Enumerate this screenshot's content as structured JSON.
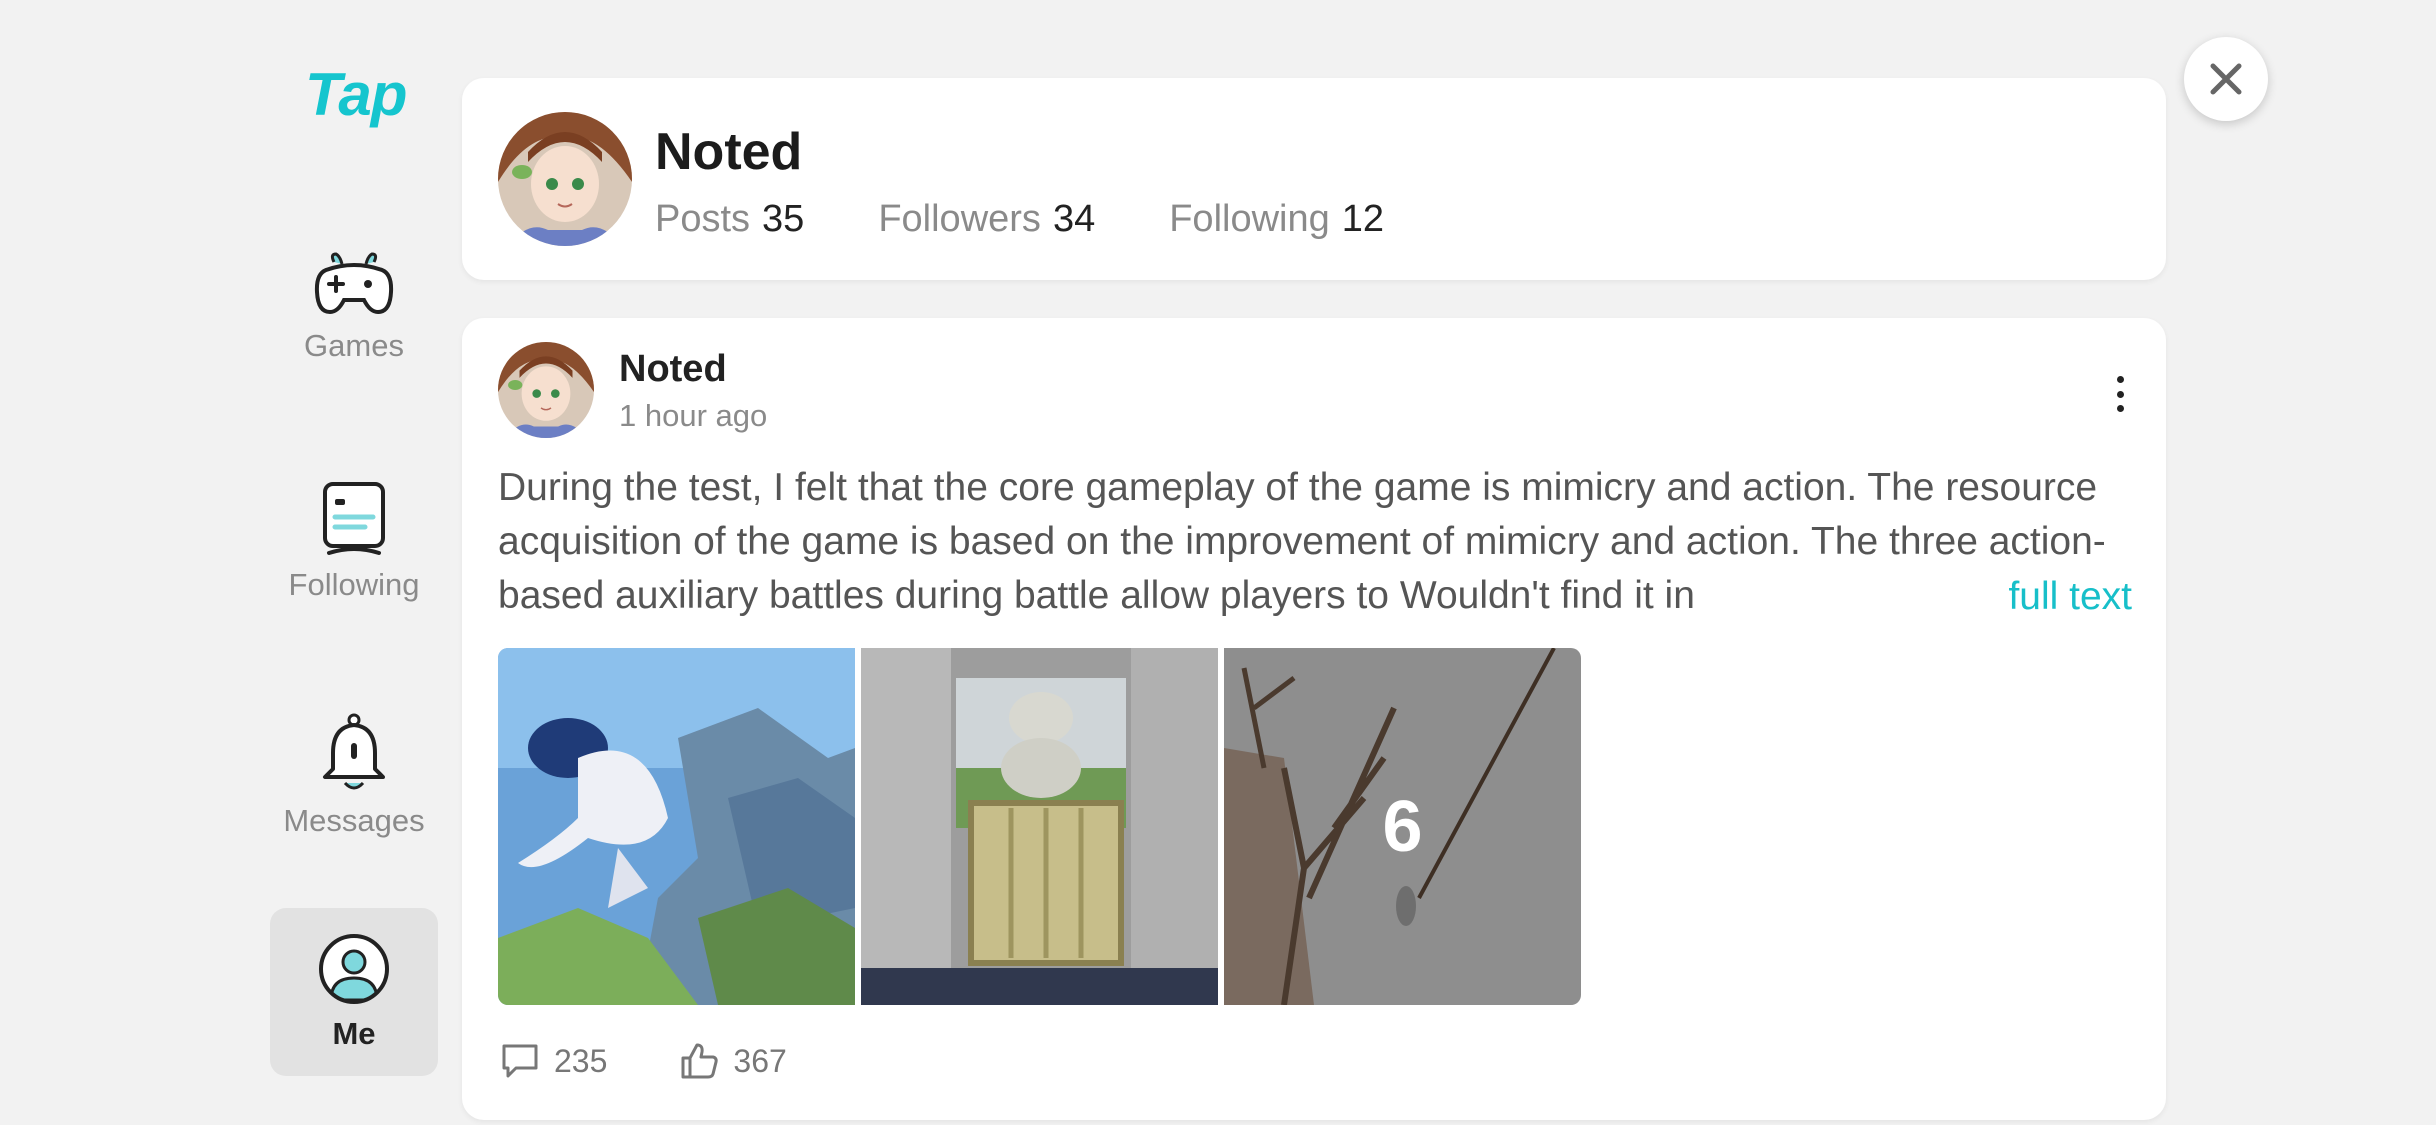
{
  "sidebar": {
    "logo": "Tap",
    "items": [
      {
        "label": "Games",
        "icon": "gamepad-icon"
      },
      {
        "label": "Following",
        "icon": "document-icon"
      },
      {
        "label": "Messages",
        "icon": "bell-icon"
      },
      {
        "label": "Me",
        "icon": "user-icon",
        "active": true
      }
    ]
  },
  "profile": {
    "name": "Noted",
    "posts_label": "Posts",
    "posts": "35",
    "followers_label": "Followers",
    "followers": "34",
    "following_label": "Following",
    "following": "12"
  },
  "post": {
    "author": "Noted",
    "time": "1 hour ago",
    "text": "During the test, I felt that the core gameplay of the game is mimicry and action. The resource acquisition of the game is based on the improvement of mimicry and action. The three action-based auxiliary battles during battle allow players to Wouldn't find it in",
    "full_text_label": "full text",
    "image_more_count": "6",
    "comments": "235",
    "likes": "367"
  },
  "colors": {
    "accent": "#15c5ce",
    "background": "#f2f2f2",
    "card": "#ffffff"
  }
}
